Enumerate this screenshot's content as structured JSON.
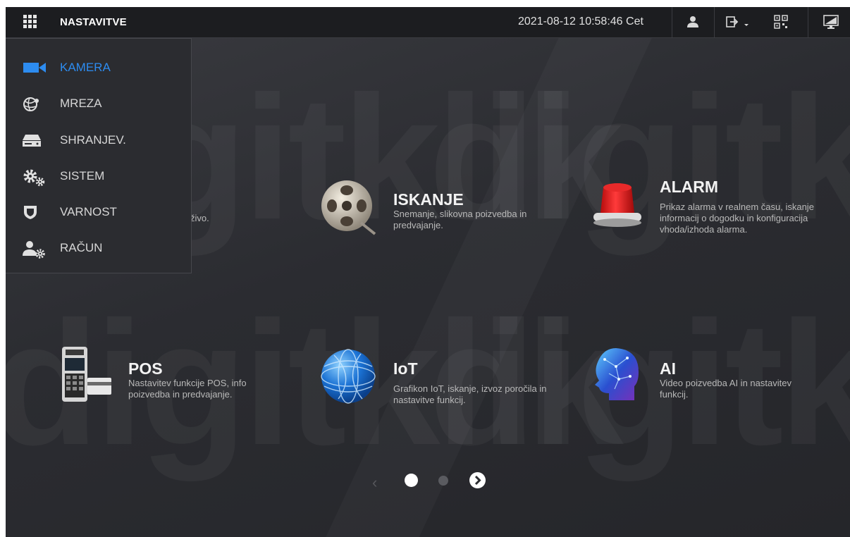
{
  "header": {
    "title": "NASTAVITVE",
    "datetime": "2021-08-12 10:58:46 Cet"
  },
  "side_menu": {
    "items": [
      {
        "label": "KAMERA",
        "icon": "camera-icon",
        "active": true
      },
      {
        "label": "MREZA",
        "icon": "network-globe-icon",
        "active": false
      },
      {
        "label": "SHRANJEV.",
        "icon": "storage-drive-icon",
        "active": false
      },
      {
        "label": "SISTEM",
        "icon": "gears-icon",
        "active": false
      },
      {
        "label": "VARNOST",
        "icon": "shield-icon",
        "active": false
      },
      {
        "label": "RAČUN",
        "icon": "user-gear-icon",
        "active": false
      }
    ]
  },
  "partial_text": "živo.",
  "tiles": [
    {
      "title": "ISKANJE",
      "desc": "Snemanje, slikovna poizvedba in predvajanje.",
      "icon": "film-reel-icon"
    },
    {
      "title": "ALARM",
      "desc": "Prikaz alarma v realnem času, iskanje informacij o dogodku in konfiguracija vhoda/izhoda alarma.",
      "icon": "siren-icon"
    },
    {
      "title": "POS",
      "desc": "Nastavitev funkcije POS, info poizvedba in predvajanje.",
      "icon": "pos-terminal-icon"
    },
    {
      "title": "IoT",
      "desc": "Grafikon IoT, iskanje, izvoz poročila in nastavitve funkcij.",
      "icon": "globe-icon"
    },
    {
      "title": "AI",
      "desc": "Video poizvedba AI in nastavitev funkcij.",
      "icon": "ai-head-icon"
    }
  ],
  "pager": {
    "current_page": 1,
    "pages": 2
  },
  "watermark": "digitklik",
  "colors": {
    "accent": "#2d8cf0",
    "topbar": "#1c1d20",
    "background": "#2e2f34",
    "alarm_red": "#e02020"
  }
}
